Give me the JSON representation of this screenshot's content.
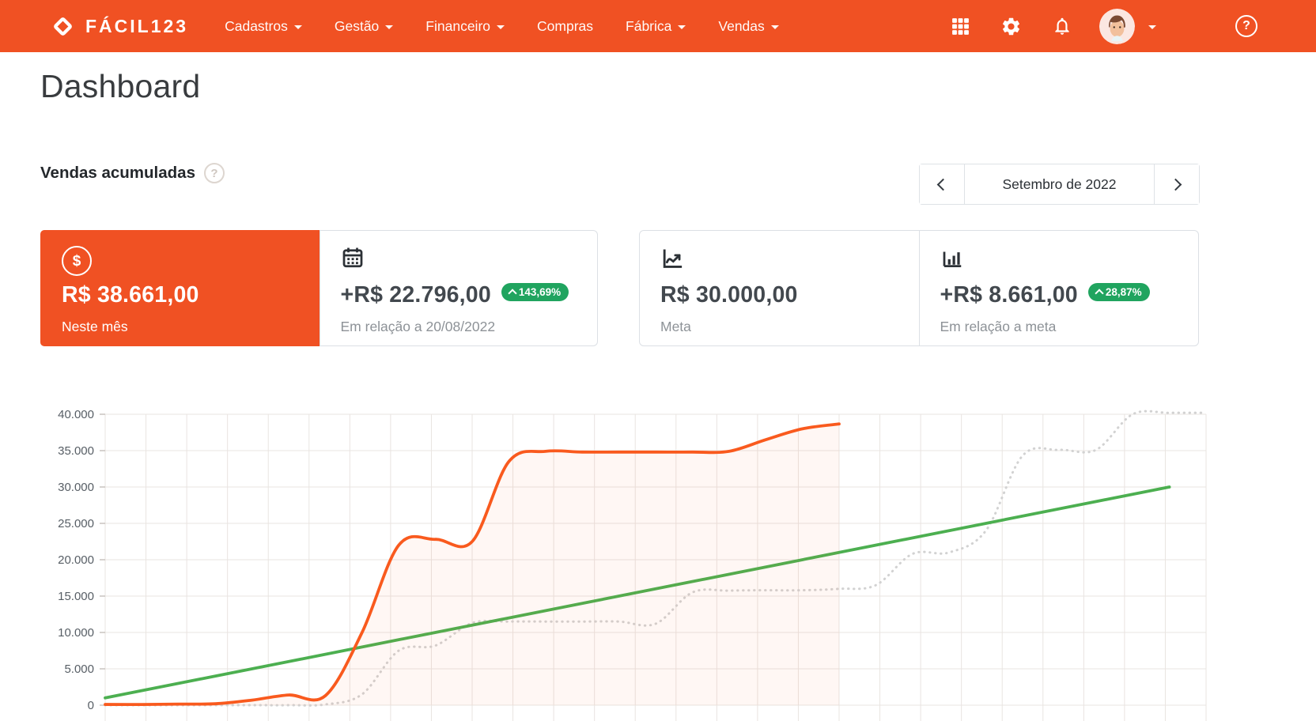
{
  "header": {
    "brand": "FÁCIL123",
    "nav": [
      {
        "label": "Cadastros",
        "dropdown": true
      },
      {
        "label": "Gestão",
        "dropdown": true
      },
      {
        "label": "Financeiro",
        "dropdown": true
      },
      {
        "label": "Compras",
        "dropdown": false
      },
      {
        "label": "Fábrica",
        "dropdown": true
      },
      {
        "label": "Vendas",
        "dropdown": true
      }
    ],
    "icons": [
      "apps-grid",
      "settings-gear",
      "notifications-bell",
      "user-avatar",
      "help"
    ]
  },
  "page": {
    "title": "Dashboard"
  },
  "section": {
    "title": "Vendas acumuladas",
    "help_icon": "question-circle"
  },
  "period": {
    "label": "Setembro de 2022",
    "prev_icon": "chevron-left",
    "next_icon": "chevron-right"
  },
  "cards": [
    {
      "icon": "currency-circle",
      "value": "R$ 38.661,00",
      "label": "Neste mês",
      "highlight": true
    },
    {
      "icon": "calendar",
      "value": "+R$ 22.796,00",
      "badge": "143,69%",
      "label": "Em relação a 20/08/2022"
    },
    {
      "icon": "line-chart",
      "value": "R$ 30.000,00",
      "label": "Meta"
    },
    {
      "icon": "bar-chart",
      "value": "+R$ 8.661,00",
      "badge": "28,87%",
      "label": "Em relação a meta"
    }
  ],
  "colors": {
    "brand_orange": "#f05123",
    "badge_green": "#20a45f",
    "line_orange": "#f95a1e",
    "line_green": "#4caf50",
    "line_gray": "#d2d2d2"
  },
  "chart_data": {
    "type": "line",
    "title": "Vendas acumuladas",
    "x_unit": "dia do mês",
    "x_range": [
      1,
      31
    ],
    "ylim": [
      0,
      40000
    ],
    "ytick_step": 5000,
    "ytick_labels": [
      "0",
      "5.000",
      "10.000",
      "15.000",
      "20.000",
      "25.000",
      "30.000",
      "35.000",
      "40.000"
    ],
    "grid": true,
    "legend": "none",
    "series": [
      {
        "name": "vendas-mes-atual",
        "color": "#f95a1e",
        "style": "solid",
        "area_fill": "rgba(249,90,30,0.05)",
        "days": [
          1,
          2,
          3,
          4,
          5,
          6,
          7,
          8,
          9,
          10,
          11,
          12,
          13,
          14,
          15,
          16,
          17,
          18,
          19,
          20,
          21
        ],
        "values": [
          100,
          100,
          150,
          200,
          700,
          1400,
          1300,
          10000,
          22000,
          22800,
          22500,
          33500,
          34900,
          34800,
          34800,
          34800,
          34800,
          34900,
          36500,
          38000,
          38661
        ]
      },
      {
        "name": "meta-linear",
        "color": "#4caf50",
        "style": "solid",
        "days": [
          1,
          30
        ],
        "values": [
          1000,
          30000
        ]
      },
      {
        "name": "vendas-mes-anterior",
        "color": "#d2d2d2",
        "style": "dotted",
        "days": [
          1,
          2,
          3,
          4,
          5,
          6,
          7,
          8,
          9,
          10,
          11,
          12,
          13,
          14,
          15,
          16,
          17,
          18,
          19,
          20,
          21,
          22,
          23,
          24,
          25,
          26,
          27,
          28,
          29,
          30,
          31
        ],
        "values": [
          0,
          0,
          0,
          0,
          0,
          0,
          100,
          1500,
          7500,
          8200,
          11300,
          11500,
          11500,
          11500,
          11500,
          11200,
          15500,
          15750,
          15800,
          15800,
          16000,
          16500,
          20800,
          21000,
          24000,
          34300,
          35100,
          35100,
          40000,
          40200,
          40200
        ]
      }
    ]
  }
}
